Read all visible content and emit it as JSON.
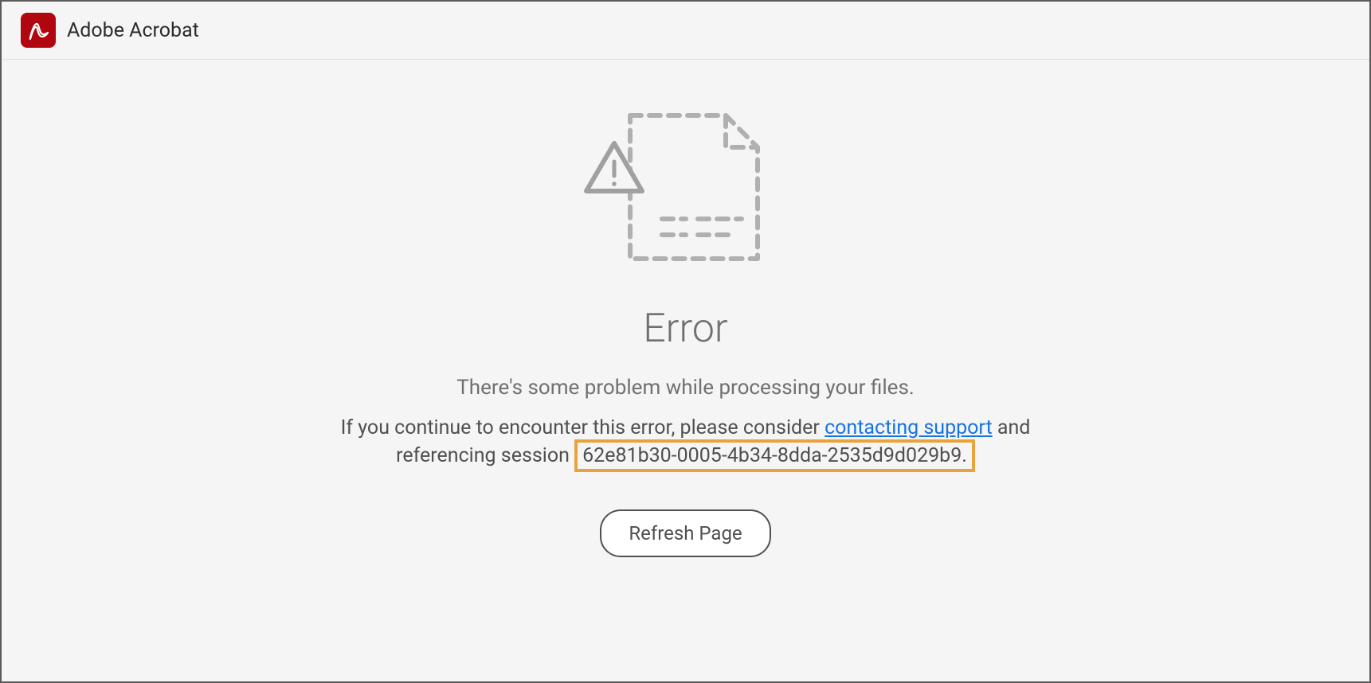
{
  "header": {
    "app_name": "Adobe Acrobat"
  },
  "error": {
    "title": "Error",
    "subtitle": "There's some problem while processing your files.",
    "detail_prefix": "If you continue to encounter this error, please consider ",
    "support_link_text": "contacting support",
    "detail_middle": " and referencing session ",
    "session_id": "62e81b30-0005-4b34-8dda-2535d9d029b9.",
    "refresh_button": "Refresh Page"
  },
  "colors": {
    "accent": "#b1060f",
    "link": "#1473e6",
    "highlight_border": "#e8a33d"
  }
}
